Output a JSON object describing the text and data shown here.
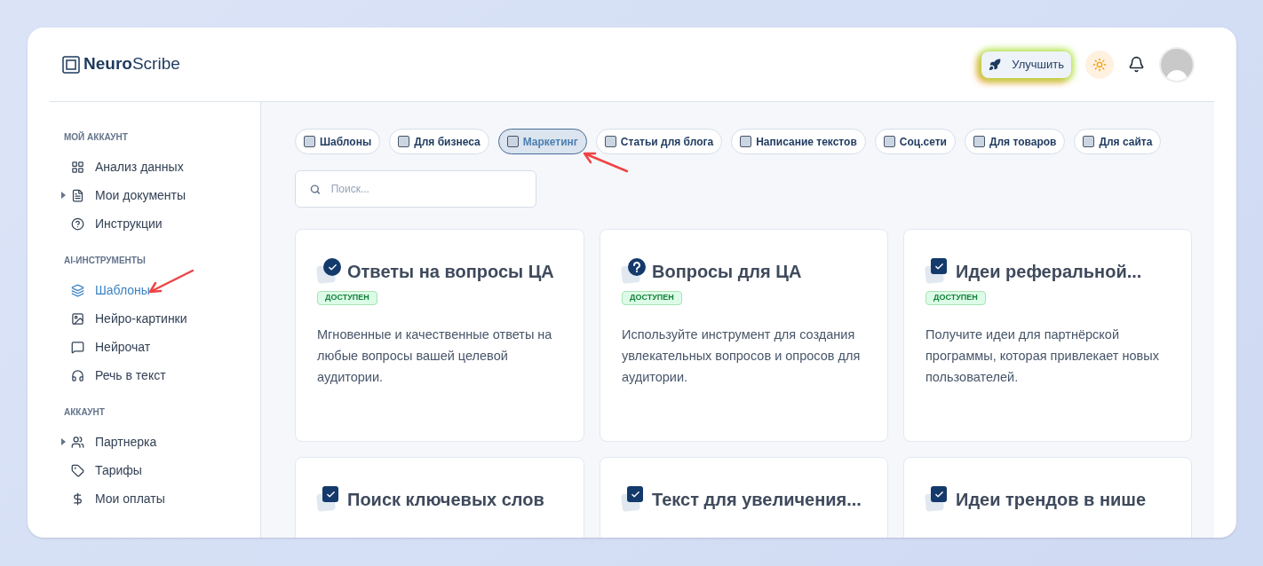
{
  "brand": {
    "bold": "Neuro",
    "light": "Scribe"
  },
  "header": {
    "upgrade": "Улучшить"
  },
  "sidebar": {
    "sections": [
      {
        "title": "МОЙ АККАУНТ",
        "items": [
          {
            "label": "Анализ данных",
            "expandable": false,
            "selected": false
          },
          {
            "label": "Мои документы",
            "expandable": true,
            "selected": false
          },
          {
            "label": "Инструкции",
            "expandable": false,
            "selected": false
          }
        ]
      },
      {
        "title": "AI-ИНСТРУМЕНТЫ",
        "items": [
          {
            "label": "Шаблоны",
            "expandable": false,
            "selected": true
          },
          {
            "label": "Нейро-картинки",
            "expandable": false,
            "selected": false
          },
          {
            "label": "Нейрочат",
            "expandable": false,
            "selected": false
          },
          {
            "label": "Речь в текст",
            "expandable": false,
            "selected": false
          }
        ]
      },
      {
        "title": "АККАУНТ",
        "items": [
          {
            "label": "Партнерка",
            "expandable": true,
            "selected": false
          },
          {
            "label": "Тарифы",
            "expandable": false,
            "selected": false
          },
          {
            "label": "Мои оплаты",
            "expandable": false,
            "selected": false
          }
        ]
      }
    ]
  },
  "categories": [
    {
      "label": "Шаблоны",
      "selected": false
    },
    {
      "label": "Для бизнеса",
      "selected": false
    },
    {
      "label": "Маркетинг",
      "selected": true
    },
    {
      "label": "Статьи для блога",
      "selected": false
    },
    {
      "label": "Написание текстов",
      "selected": false
    },
    {
      "label": "Соц.сети",
      "selected": false
    },
    {
      "label": "Для товаров",
      "selected": false
    },
    {
      "label": "Для сайта",
      "selected": false
    }
  ],
  "search": {
    "placeholder": "Поиск..."
  },
  "cards": [
    {
      "kind": "check-circle",
      "title": "Ответы на вопросы ЦА",
      "badge": "ДОСТУПЕН",
      "description": "Мгновенные и качественные ответы на любые вопросы вашей целевой аудитории."
    },
    {
      "kind": "question-circle",
      "title": "Вопросы для ЦА",
      "badge": "ДОСТУПЕН",
      "description": "Используйте инструмент для создания увлекательных вопросов и опросов для аудитории."
    },
    {
      "kind": "check-square",
      "title": "Идеи реферальной...",
      "badge": "ДОСТУПЕН",
      "description": "Получите идеи для партнёрской программы, которая привлекает новых пользователей."
    },
    {
      "kind": "check-square",
      "title": "Поиск ключевых слов"
    },
    {
      "kind": "check-square",
      "title": "Текст для увеличения..."
    },
    {
      "kind": "check-square",
      "title": "Идеи трендов в нише"
    }
  ]
}
